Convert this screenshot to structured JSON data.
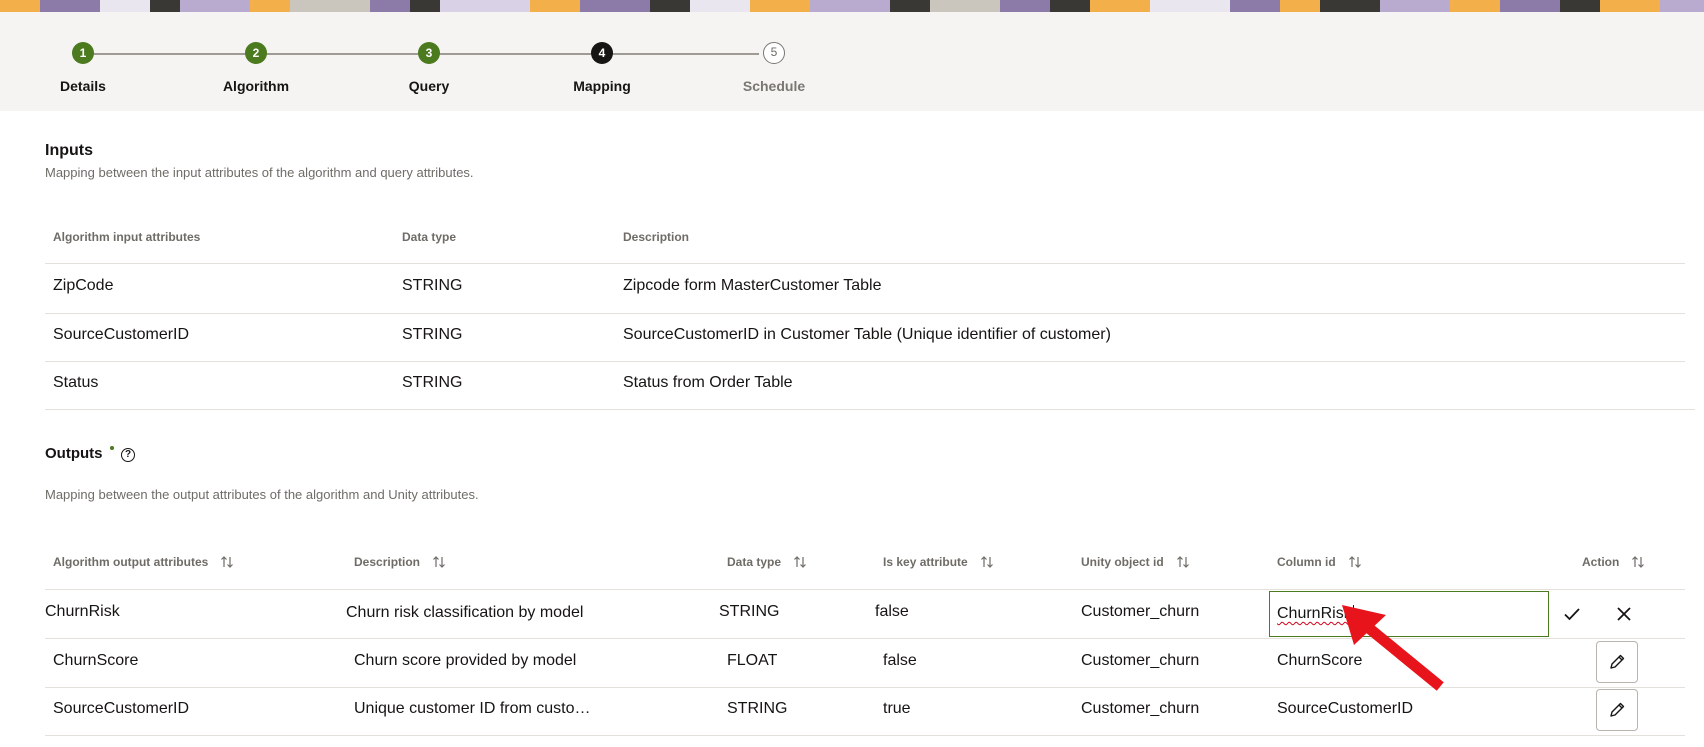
{
  "stepper": {
    "steps": [
      {
        "number": "1",
        "label": "Details"
      },
      {
        "number": "2",
        "label": "Algorithm"
      },
      {
        "number": "3",
        "label": "Query"
      },
      {
        "number": "4",
        "label": "Mapping"
      },
      {
        "number": "5",
        "label": "Schedule"
      }
    ],
    "current_step": 4
  },
  "inputs": {
    "title": "Inputs",
    "subtitle": "Mapping between the input attributes of the algorithm and query attributes.",
    "columns": [
      "Algorithm input attributes",
      "Data type",
      "Description"
    ],
    "rows": [
      {
        "attribute": "ZipCode",
        "data_type": "STRING",
        "description": "Zipcode form MasterCustomer Table"
      },
      {
        "attribute": "SourceCustomerID",
        "data_type": "STRING",
        "description": "SourceCustomerID in Customer Table (Unique identifier of customer)"
      },
      {
        "attribute": "Status",
        "data_type": "STRING",
        "description": "Status from Order Table"
      }
    ]
  },
  "outputs": {
    "title": "Outputs",
    "help_icon": "question-circle",
    "subtitle": "Mapping between the output attributes of the algorithm and Unity attributes.",
    "columns": [
      "Algorithm output attributes",
      "Description",
      "Data type",
      "Is key attribute",
      "Unity object id",
      "Column id",
      "Action"
    ],
    "rows": [
      {
        "attribute": "ChurnRisk",
        "description": "Churn risk classification by model",
        "data_type": "STRING",
        "is_key": "false",
        "unity_object_id": "Customer_churn",
        "column_id": "ChurnRisk"
      },
      {
        "attribute": "ChurnScore",
        "description": "Churn score provided by model",
        "data_type": "FLOAT",
        "is_key": "false",
        "unity_object_id": "Customer_churn",
        "column_id": "ChurnScore"
      },
      {
        "attribute": "SourceCustomerID",
        "description": "Unique customer ID from custo…",
        "data_type": "STRING",
        "is_key": "true",
        "unity_object_id": "Customer_churn",
        "column_id": "SourceCustomerID"
      }
    ],
    "editing_row": 0
  },
  "colors": {
    "complete_step": "#4c7a1f",
    "current_step": "#161513",
    "edit_border": "#4c7a1f",
    "annotation_arrow": "#e8141b"
  }
}
